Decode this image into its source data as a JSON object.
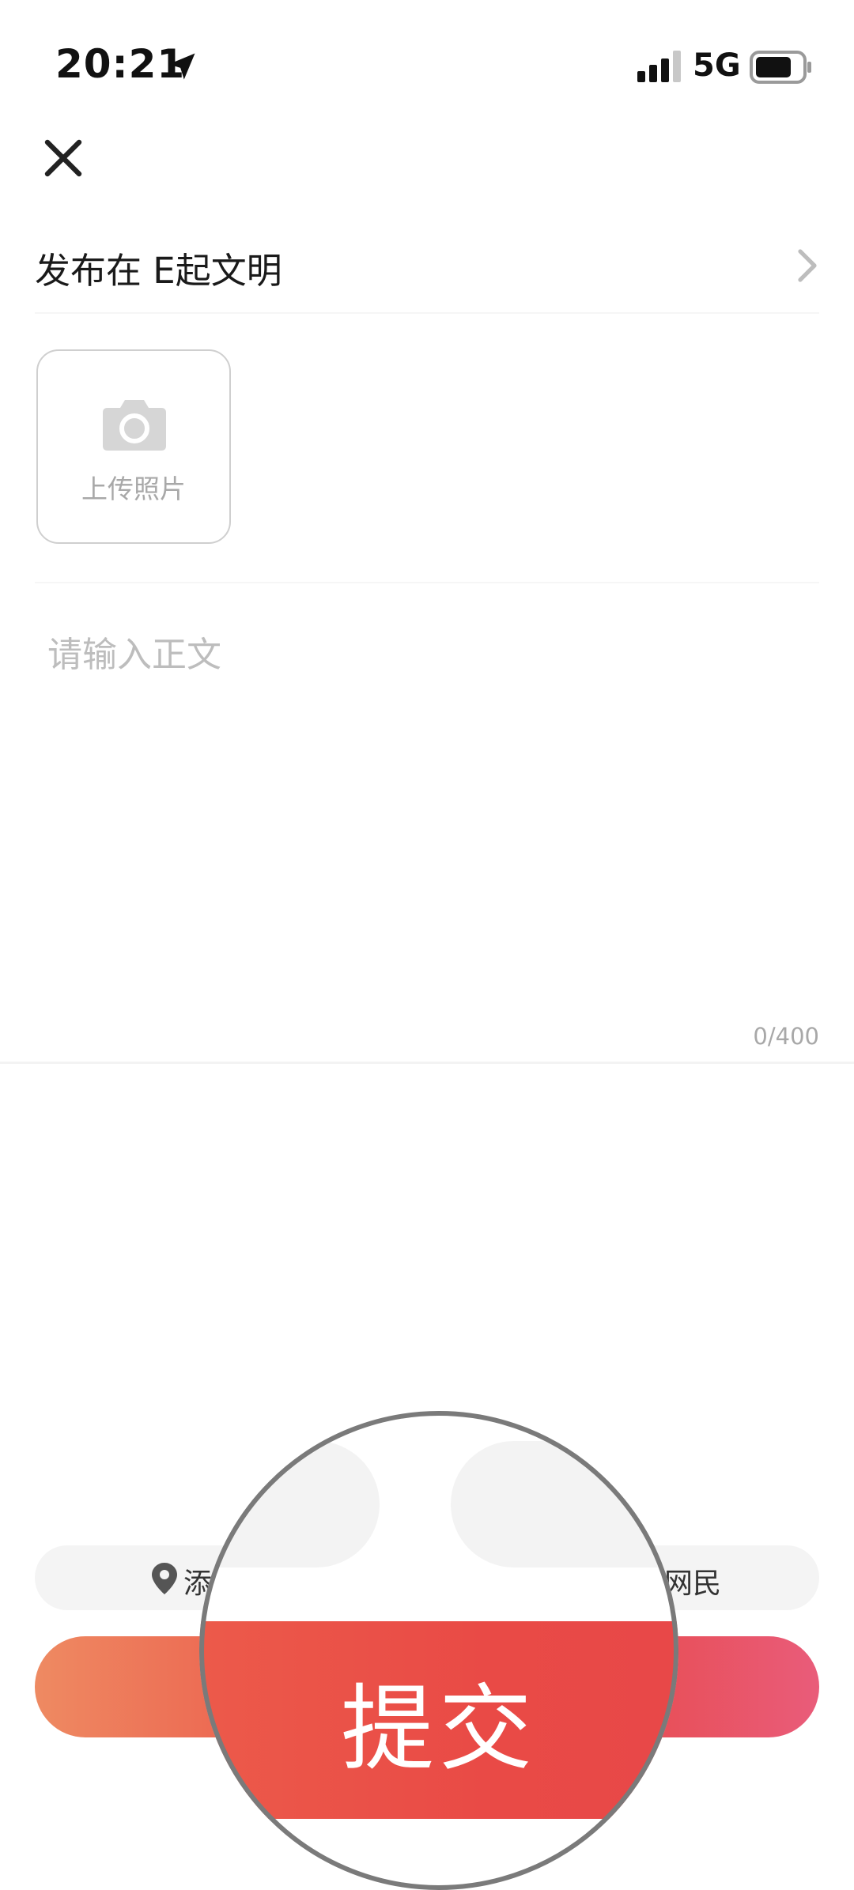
{
  "status_bar": {
    "time": "20:21",
    "network": "5G"
  },
  "publish": {
    "label": "发布在 E起文明"
  },
  "upload": {
    "label": "上传照片"
  },
  "body": {
    "placeholder": "请输入正文",
    "counter": "0/400"
  },
  "options": {
    "location_label": "添",
    "identity_label": "网民"
  },
  "submit": {
    "label": "提交"
  },
  "colors": {
    "accent_start": "#ee8a62",
    "accent_mid": "#e84a4a",
    "accent_end": "#e95c7a"
  }
}
